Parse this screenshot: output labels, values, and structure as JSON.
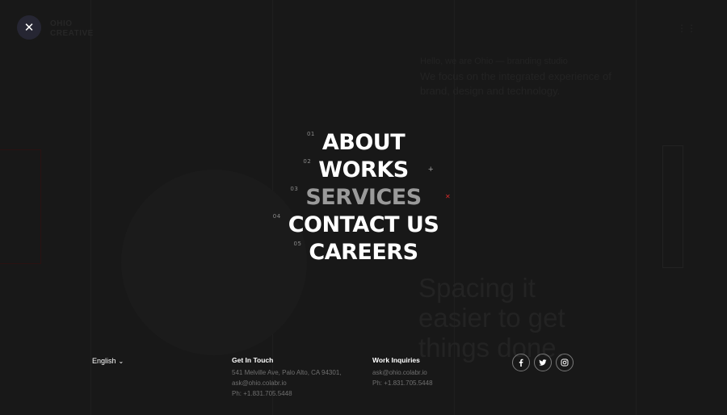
{
  "menu": {
    "items": [
      {
        "num": "01",
        "label": "ABOUT"
      },
      {
        "num": "02",
        "label": "WORKS"
      },
      {
        "num": "03",
        "label": "SERVICES"
      },
      {
        "num": "04",
        "label": "CONTACT US"
      },
      {
        "num": "05",
        "label": "CAREERS"
      }
    ],
    "active_index": 2
  },
  "footer": {
    "language": "English",
    "get_in_touch": {
      "heading": "Get In Touch",
      "address": "541 Melville Ave, Palo Alto, CA 94301,",
      "email": "ask@ohio.colabr.io",
      "phone": "Ph: +1.831.705.5448"
    },
    "work_inquiries": {
      "heading": "Work Inquiries",
      "email": "ask@ohio.colabr.io",
      "phone": "Ph: +1.831.705.5448"
    },
    "socials": [
      "facebook-icon",
      "twitter-icon",
      "instagram-icon"
    ]
  },
  "background": {
    "logo": "OHIO CREATIVE",
    "intro_small": "Hello, we are Ohio — branding studio",
    "intro_lead": "We focus on the integrated experience of brand, design and technology.",
    "headline": "Spacing it easier to get things done."
  },
  "colors": {
    "background": "#181818",
    "close_button": "#262633",
    "active_item": "#9a9a9a",
    "accent_red": "#d72a2a"
  }
}
